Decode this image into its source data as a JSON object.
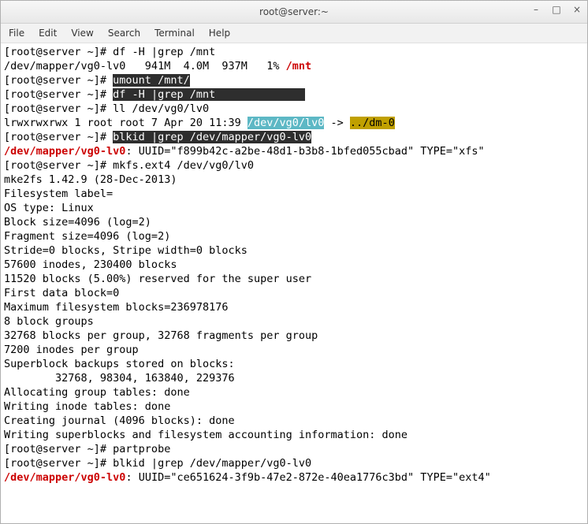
{
  "window": {
    "title": "root@server:~"
  },
  "menu": {
    "file": "File",
    "edit": "Edit",
    "view": "View",
    "search": "Search",
    "terminal": "Terminal",
    "help": "Help"
  },
  "controls": {
    "min": "–",
    "max": "□",
    "close": "×"
  },
  "prompt": "[root@server ~]# ",
  "cmds": {
    "df1": "df -H |grep /mnt",
    "df1_out_a": "/dev/mapper/vg0-lv0   941M  4.0M  937M   1% ",
    "df1_out_red": "/mnt",
    "umount": "umount /mnt/",
    "df2": "df -H |grep /mnt",
    "ll": "ll /dev/vg0/lv0",
    "ll_out_a": "lrwxrwxrwx 1 root root 7 Apr 20 11:39 ",
    "ll_out_link": "/dev/vg0/lv0",
    "ll_out_arrow": " -> ",
    "ll_out_tgt": "../dm-0",
    "blkid1": "blkid |grep /dev/mapper/vg0-lv0",
    "blkid1_dev": "/dev/mapper/vg0-lv0",
    "blkid1_rest": ": UUID=\"f899b42c-a2be-48d1-b3b8-1bfed055cbad\" TYPE=\"xfs\"",
    "mkfs": "mkfs.ext4 /dev/vg0/lv0",
    "mkfs_out": [
      "mke2fs 1.42.9 (28-Dec-2013)",
      "Filesystem label=",
      "OS type: Linux",
      "Block size=4096 (log=2)",
      "Fragment size=4096 (log=2)",
      "Stride=0 blocks, Stripe width=0 blocks",
      "57600 inodes, 230400 blocks",
      "11520 blocks (5.00%) reserved for the super user",
      "First data block=0",
      "Maximum filesystem blocks=236978176",
      "8 block groups",
      "32768 blocks per group, 32768 fragments per group",
      "7200 inodes per group",
      "Superblock backups stored on blocks:",
      "        32768, 98304, 163840, 229376",
      "",
      "Allocating group tables: done",
      "Writing inode tables: done",
      "Creating journal (4096 blocks): done",
      "Writing superblocks and filesystem accounting information: done",
      ""
    ],
    "partprobe": "partprobe",
    "blkid2": "blkid |grep /dev/mapper/vg0-lv0",
    "blkid2_dev": "/dev/mapper/vg0-lv0",
    "blkid2_rest": ": UUID=\"ce651624-3f9b-47e2-872e-40ea1776c3bd\" TYPE=\"ext4\""
  },
  "watermark": ""
}
